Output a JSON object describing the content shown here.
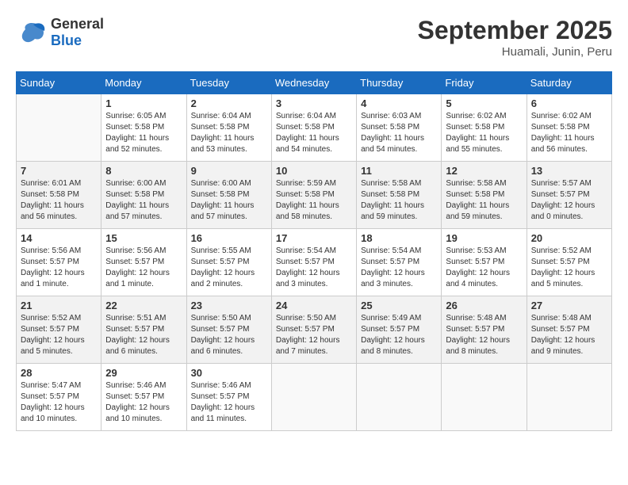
{
  "header": {
    "logo_line1": "General",
    "logo_line2": "Blue",
    "month": "September 2025",
    "location": "Huamali, Junin, Peru"
  },
  "days_of_week": [
    "Sunday",
    "Monday",
    "Tuesday",
    "Wednesday",
    "Thursday",
    "Friday",
    "Saturday"
  ],
  "weeks": [
    [
      {
        "day": "",
        "info": ""
      },
      {
        "day": "1",
        "info": "Sunrise: 6:05 AM\nSunset: 5:58 PM\nDaylight: 11 hours\nand 52 minutes."
      },
      {
        "day": "2",
        "info": "Sunrise: 6:04 AM\nSunset: 5:58 PM\nDaylight: 11 hours\nand 53 minutes."
      },
      {
        "day": "3",
        "info": "Sunrise: 6:04 AM\nSunset: 5:58 PM\nDaylight: 11 hours\nand 54 minutes."
      },
      {
        "day": "4",
        "info": "Sunrise: 6:03 AM\nSunset: 5:58 PM\nDaylight: 11 hours\nand 54 minutes."
      },
      {
        "day": "5",
        "info": "Sunrise: 6:02 AM\nSunset: 5:58 PM\nDaylight: 11 hours\nand 55 minutes."
      },
      {
        "day": "6",
        "info": "Sunrise: 6:02 AM\nSunset: 5:58 PM\nDaylight: 11 hours\nand 56 minutes."
      }
    ],
    [
      {
        "day": "7",
        "info": "Sunrise: 6:01 AM\nSunset: 5:58 PM\nDaylight: 11 hours\nand 56 minutes."
      },
      {
        "day": "8",
        "info": "Sunrise: 6:00 AM\nSunset: 5:58 PM\nDaylight: 11 hours\nand 57 minutes."
      },
      {
        "day": "9",
        "info": "Sunrise: 6:00 AM\nSunset: 5:58 PM\nDaylight: 11 hours\nand 57 minutes."
      },
      {
        "day": "10",
        "info": "Sunrise: 5:59 AM\nSunset: 5:58 PM\nDaylight: 11 hours\nand 58 minutes."
      },
      {
        "day": "11",
        "info": "Sunrise: 5:58 AM\nSunset: 5:58 PM\nDaylight: 11 hours\nand 59 minutes."
      },
      {
        "day": "12",
        "info": "Sunrise: 5:58 AM\nSunset: 5:58 PM\nDaylight: 11 hours\nand 59 minutes."
      },
      {
        "day": "13",
        "info": "Sunrise: 5:57 AM\nSunset: 5:57 PM\nDaylight: 12 hours\nand 0 minutes."
      }
    ],
    [
      {
        "day": "14",
        "info": "Sunrise: 5:56 AM\nSunset: 5:57 PM\nDaylight: 12 hours\nand 1 minute."
      },
      {
        "day": "15",
        "info": "Sunrise: 5:56 AM\nSunset: 5:57 PM\nDaylight: 12 hours\nand 1 minute."
      },
      {
        "day": "16",
        "info": "Sunrise: 5:55 AM\nSunset: 5:57 PM\nDaylight: 12 hours\nand 2 minutes."
      },
      {
        "day": "17",
        "info": "Sunrise: 5:54 AM\nSunset: 5:57 PM\nDaylight: 12 hours\nand 3 minutes."
      },
      {
        "day": "18",
        "info": "Sunrise: 5:54 AM\nSunset: 5:57 PM\nDaylight: 12 hours\nand 3 minutes."
      },
      {
        "day": "19",
        "info": "Sunrise: 5:53 AM\nSunset: 5:57 PM\nDaylight: 12 hours\nand 4 minutes."
      },
      {
        "day": "20",
        "info": "Sunrise: 5:52 AM\nSunset: 5:57 PM\nDaylight: 12 hours\nand 5 minutes."
      }
    ],
    [
      {
        "day": "21",
        "info": "Sunrise: 5:52 AM\nSunset: 5:57 PM\nDaylight: 12 hours\nand 5 minutes."
      },
      {
        "day": "22",
        "info": "Sunrise: 5:51 AM\nSunset: 5:57 PM\nDaylight: 12 hours\nand 6 minutes."
      },
      {
        "day": "23",
        "info": "Sunrise: 5:50 AM\nSunset: 5:57 PM\nDaylight: 12 hours\nand 6 minutes."
      },
      {
        "day": "24",
        "info": "Sunrise: 5:50 AM\nSunset: 5:57 PM\nDaylight: 12 hours\nand 7 minutes."
      },
      {
        "day": "25",
        "info": "Sunrise: 5:49 AM\nSunset: 5:57 PM\nDaylight: 12 hours\nand 8 minutes."
      },
      {
        "day": "26",
        "info": "Sunrise: 5:48 AM\nSunset: 5:57 PM\nDaylight: 12 hours\nand 8 minutes."
      },
      {
        "day": "27",
        "info": "Sunrise: 5:48 AM\nSunset: 5:57 PM\nDaylight: 12 hours\nand 9 minutes."
      }
    ],
    [
      {
        "day": "28",
        "info": "Sunrise: 5:47 AM\nSunset: 5:57 PM\nDaylight: 12 hours\nand 10 minutes."
      },
      {
        "day": "29",
        "info": "Sunrise: 5:46 AM\nSunset: 5:57 PM\nDaylight: 12 hours\nand 10 minutes."
      },
      {
        "day": "30",
        "info": "Sunrise: 5:46 AM\nSunset: 5:57 PM\nDaylight: 12 hours\nand 11 minutes."
      },
      {
        "day": "",
        "info": ""
      },
      {
        "day": "",
        "info": ""
      },
      {
        "day": "",
        "info": ""
      },
      {
        "day": "",
        "info": ""
      }
    ]
  ]
}
